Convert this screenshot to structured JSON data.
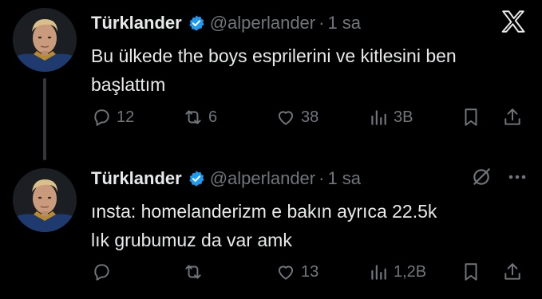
{
  "tweets": [
    {
      "name": "Türklander",
      "handle": "@alperlander",
      "separator": "·",
      "time": "1 sa",
      "text_lines": [
        "Bu ülkede the boys esprilerini ve kitlesini ben",
        "başlattım"
      ],
      "replies": "12",
      "retweets": "6",
      "likes": "38",
      "views": "3B"
    },
    {
      "name": "Türklander",
      "handle": "@alperlander",
      "separator": "·",
      "time": "1 sa",
      "text_lines": [
        "ınsta: homelanderizm e bakın ayrıca 22.5k",
        "lık grubumuz da var amk"
      ],
      "replies": "",
      "retweets": "",
      "likes": "13",
      "views": "1,2B"
    }
  ],
  "icons": {
    "brand": "x-logo-icon",
    "verified": "verified-badge-icon",
    "grok": "grok-icon",
    "more": "more-options-icon",
    "reply": "reply-icon",
    "retweet": "retweet-icon",
    "like": "heart-icon",
    "views": "views-icon",
    "bookmark": "bookmark-icon",
    "share": "share-icon"
  },
  "colors": {
    "background": "#000000",
    "text": "#e7e9ea",
    "secondary": "#71767b",
    "verified": "#1d9bf0"
  }
}
